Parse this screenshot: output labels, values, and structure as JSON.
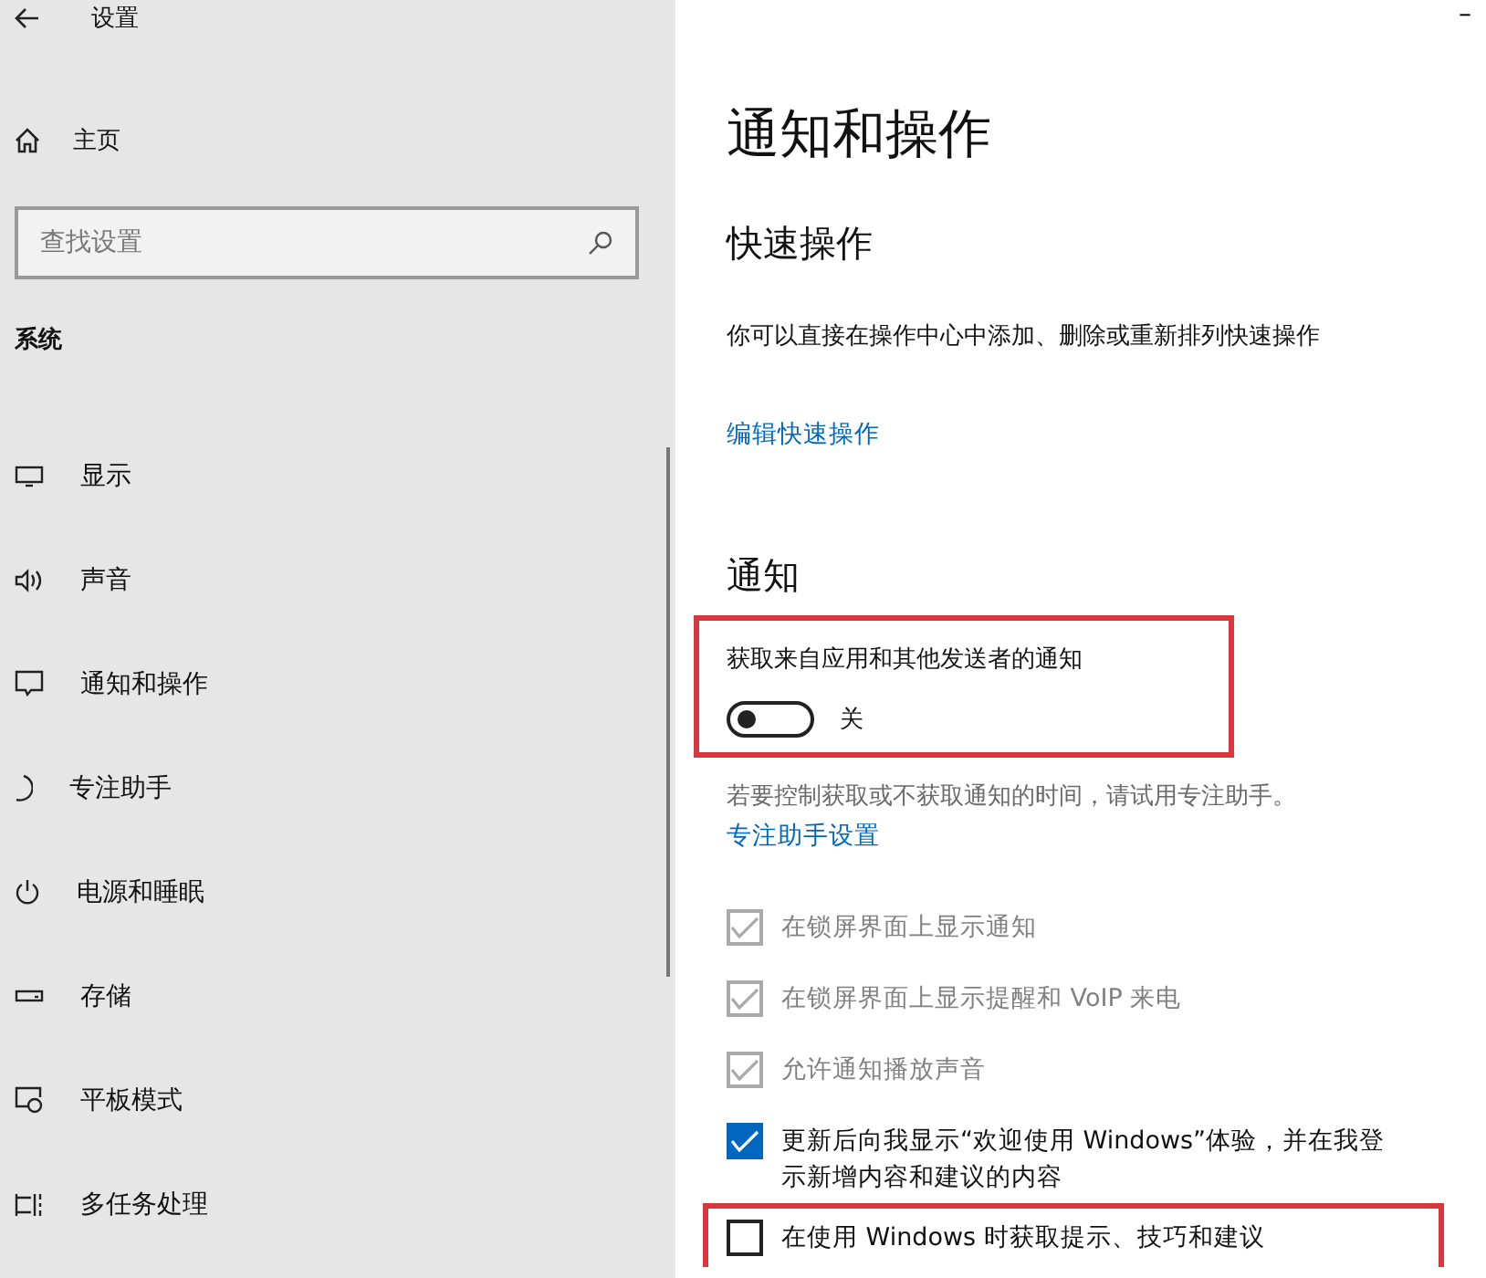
{
  "window": {
    "title": "设置",
    "minimize": "–"
  },
  "sidebar": {
    "home": "主页",
    "search": {
      "placeholder": "查找设置"
    },
    "section": "系统",
    "items": [
      {
        "label": "显示",
        "selected": false
      },
      {
        "label": "声音",
        "selected": false
      },
      {
        "label": "通知和操作",
        "selected": false
      },
      {
        "label": "专注助手",
        "selected": false
      },
      {
        "label": "电源和睡眠",
        "selected": false
      },
      {
        "label": "存储",
        "selected": false
      },
      {
        "label": "平板模式",
        "selected": false
      },
      {
        "label": "多任务处理",
        "selected": false
      }
    ]
  },
  "page": {
    "title": "通知和操作",
    "quick_actions": {
      "heading": "快速操作",
      "description": "你可以直接在操作中心中添加、删除或重新排列快速操作",
      "link": "编辑快速操作"
    },
    "notifications": {
      "heading": "通知",
      "toggle": {
        "label": "获取来自应用和其他发送者的通知",
        "on": false,
        "state_text": "关",
        "highlighted": true
      },
      "hint": "若要控制获取或不获取通知的时间，请试用专注助手。",
      "hint_link": "专注助手设置",
      "options": [
        {
          "label": "在锁屏界面上显示通知",
          "checked": true,
          "disabled": true,
          "highlighted": false
        },
        {
          "label": "在锁屏界面上显示提醒和 VoIP 来电",
          "checked": true,
          "disabled": true,
          "highlighted": false
        },
        {
          "label": "允许通知播放声音",
          "checked": true,
          "disabled": true,
          "highlighted": false
        },
        {
          "label": "更新后向我显示“欢迎使用 Windows”体验，并在我登",
          "label_line_2": "示新增内容和建议的内容",
          "checked": true,
          "disabled": false,
          "highlighted": false
        },
        {
          "label": "在使用 Windows 时获取提示、技巧和建议",
          "checked": false,
          "disabled": false,
          "highlighted": true
        }
      ]
    }
  }
}
